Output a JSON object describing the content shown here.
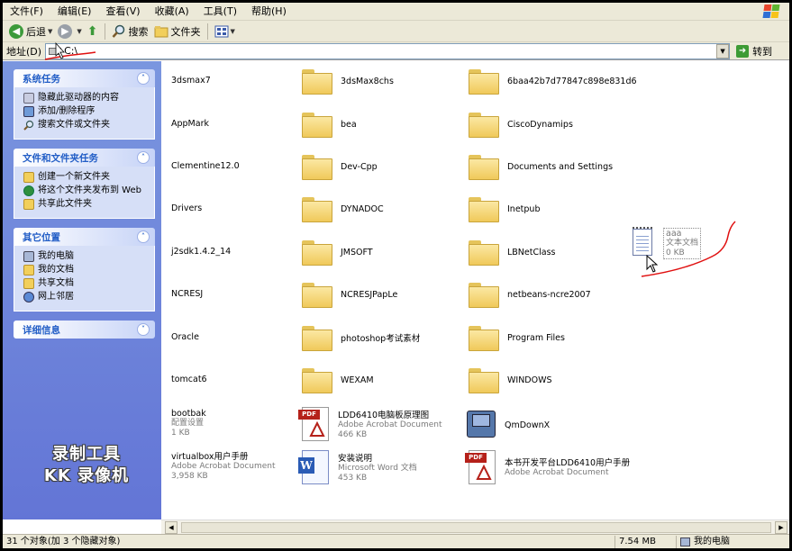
{
  "menubar": {
    "items": [
      "文件(F)",
      "编辑(E)",
      "查看(V)",
      "收藏(A)",
      "工具(T)",
      "帮助(H)"
    ]
  },
  "toolbar": {
    "back": "后退",
    "search": "搜索",
    "folders": "文件夹"
  },
  "address": {
    "label": "地址(D)",
    "value": "C:\\",
    "go": "转到"
  },
  "taskpane": {
    "system_tasks": {
      "title": "系统任务",
      "items": [
        "隐藏此驱动器的内容",
        "添加/删除程序",
        "搜索文件或文件夹"
      ]
    },
    "file_tasks": {
      "title": "文件和文件夹任务",
      "items": [
        "创建一个新文件夹",
        "将这个文件夹发布到 Web",
        "共享此文件夹"
      ]
    },
    "other_places": {
      "title": "其它位置",
      "items": [
        "我的电脑",
        "我的文档",
        "共享文档",
        "网上邻居"
      ]
    },
    "details": {
      "title": "详细信息"
    },
    "watermark": [
      "录制工具",
      "KK 录像机"
    ]
  },
  "files": {
    "col1": [
      "3dsmax7",
      "AppMark",
      "Clementine12.0",
      "Drivers",
      "j2sdk1.4.2_14",
      "NCRESJ",
      "Oracle",
      "tomcat6"
    ],
    "col2": [
      "3dsMax8chs",
      "bea",
      "Dev-Cpp",
      "DYNADOC",
      "JMSOFT",
      "NCRESJPapLe",
      "photoshop考试素材",
      "WEXAM"
    ],
    "col3": [
      "6baa42b7d77847c898e831d6",
      "CiscoDynamips",
      "Documents and Settings",
      "Inetpub",
      "LBNetClass",
      "netbeans-ncre2007",
      "Program Files",
      "WINDOWS"
    ],
    "bootbak": {
      "name": "bootbak",
      "type": "配置设置",
      "size": "1 KB"
    },
    "lddpdf": {
      "name": "LDD6410电脑板原理图",
      "type": "Adobe Acrobat Document",
      "size": "466 KB"
    },
    "qmdown": {
      "name": "QmDownX"
    },
    "vbox": {
      "name": "virtualbox用户手册",
      "type": "Adobe Acrobat Document",
      "size": "3,958 KB"
    },
    "install": {
      "name": "安装说明",
      "type": "Microsoft Word 文档",
      "size": "453 KB"
    },
    "devpdf": {
      "name": "本书开发平台LDD6410用户手册",
      "type": "Adobe Acrobat Document"
    },
    "aaa": {
      "name": "aaa",
      "type": "文本文档",
      "size": "0 KB"
    }
  },
  "statusbar": {
    "objects": "31 个对象(加 3 个隐藏对象)",
    "size": "7.54 MB",
    "location": "我的电脑"
  },
  "colors": {
    "taskpane_bg": "#6b86d8",
    "accent_link": "#215dc6",
    "annotation": "#e01010"
  }
}
